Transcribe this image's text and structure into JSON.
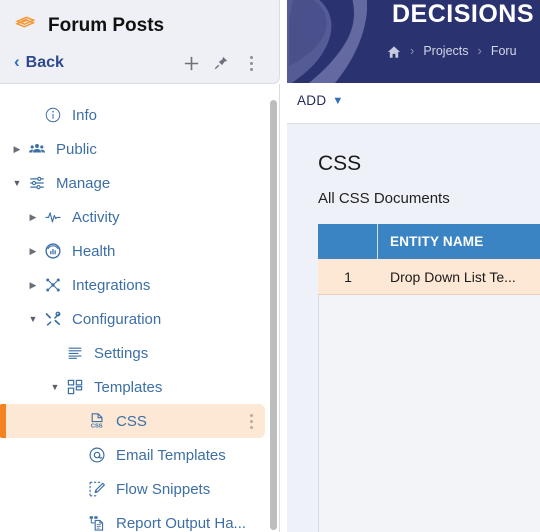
{
  "app": {
    "brand": "DECISIONS",
    "breadcrumb": [
      {
        "icon": "home-icon",
        "label": ""
      },
      {
        "label": "Projects"
      },
      {
        "label": "Foru"
      }
    ],
    "toolbar": {
      "add_label": "ADD",
      "add_chevron": "chevron-down-icon"
    },
    "page": {
      "title": "CSS",
      "subtitle": "All CSS Documents"
    },
    "grid": {
      "columns": [
        "",
        "ENTITY NAME"
      ],
      "rows": [
        {
          "num": "1",
          "entity_name": "Drop Down List Te..."
        }
      ]
    }
  },
  "flyout": {
    "icon": "forum-posts-icon",
    "title": "Forum Posts",
    "back_label": "Back",
    "tools": [
      {
        "name": "add-icon",
        "glyph": "+"
      },
      {
        "name": "pin-icon",
        "glyph": "pin"
      },
      {
        "name": "kebab-menu-icon",
        "glyph": "dots"
      }
    ],
    "tree": [
      {
        "label": "Info",
        "icon": "info-icon",
        "indent": 1,
        "arrow": "none",
        "selected": false
      },
      {
        "label": "Public",
        "icon": "users-icon",
        "indent": 0,
        "arrow": "right",
        "selected": false
      },
      {
        "label": "Manage",
        "icon": "sliders-icon",
        "indent": 0,
        "arrow": "down",
        "selected": false
      },
      {
        "label": "Activity",
        "icon": "pulse-icon",
        "indent": 1,
        "arrow": "right",
        "selected": false
      },
      {
        "label": "Health",
        "icon": "health-gauge-icon",
        "indent": 1,
        "arrow": "right",
        "selected": false
      },
      {
        "label": "Integrations",
        "icon": "integrations-icon",
        "indent": 1,
        "arrow": "right",
        "selected": false
      },
      {
        "label": "Configuration",
        "icon": "tools-icon",
        "indent": 1,
        "arrow": "down",
        "selected": false
      },
      {
        "label": "Settings",
        "icon": "settings-list-icon",
        "indent": 2,
        "arrow": "none",
        "selected": false
      },
      {
        "label": "Templates",
        "icon": "templates-icon",
        "indent": 2,
        "arrow": "down",
        "selected": false
      },
      {
        "label": "CSS",
        "icon": "css-file-icon",
        "indent": 3,
        "arrow": "none",
        "selected": true
      },
      {
        "label": "Email Templates",
        "icon": "at-icon",
        "indent": 3,
        "arrow": "none",
        "selected": false
      },
      {
        "label": "Flow Snippets",
        "icon": "flow-snippet-icon",
        "indent": 3,
        "arrow": "none",
        "selected": false
      },
      {
        "label": "Report Output Ha...",
        "icon": "report-output-icon",
        "indent": 3,
        "arrow": "none",
        "selected": false
      }
    ]
  },
  "colors": {
    "header_navy": "#2b3270",
    "accent_orange": "#f58220",
    "selected_row_peach": "#fce8d5",
    "grid_header_blue": "#3b84c4",
    "tree_link_blue": "#3d6fa5"
  }
}
